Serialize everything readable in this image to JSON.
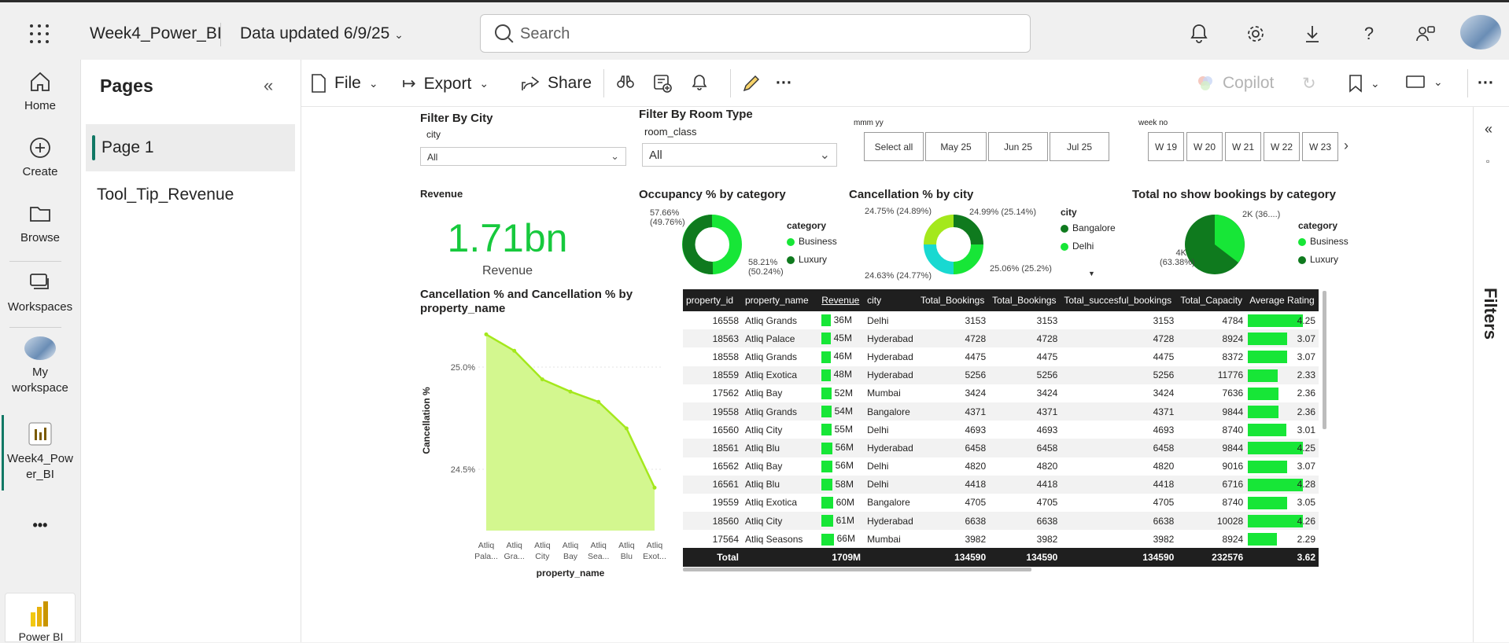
{
  "topbar": {
    "workspace_name": "Week4_Power_BI",
    "data_updated": "Data updated 6/9/25",
    "search_placeholder": "Search"
  },
  "rail": {
    "home": "Home",
    "create": "Create",
    "browse": "Browse",
    "workspaces": "Workspaces",
    "my_workspace": "My workspace",
    "report": "Week4_Power_BI",
    "more": "•••",
    "powerbi": "Power BI"
  },
  "pages": {
    "title": "Pages",
    "items": [
      "Page 1",
      "Tool_Tip_Revenue"
    ]
  },
  "ribbon": {
    "file": "File",
    "export": "Export",
    "share": "Share",
    "copilot": "Copilot"
  },
  "report": {
    "filter_city_title": "Filter By City",
    "filter_city_field": "city",
    "filter_city_value": "All",
    "filter_room_title": "Filter By Room Type",
    "filter_room_field": "room_class",
    "filter_room_value": "All",
    "mmm_label": "mmm yy",
    "months": [
      "Select all",
      "May 25",
      "Jun 25",
      "Jul 25"
    ],
    "week_label": "week no",
    "weeks": [
      "W 19",
      "W 20",
      "W 21",
      "W 22",
      "W 23"
    ],
    "revenue_title": "Revenue",
    "revenue_value": "1.71bn",
    "revenue_sub": "Revenue",
    "occupancy_title": "Occupancy % by category",
    "occupancy_label_top": "57.66%",
    "occupancy_label_top2": "(49.76%)",
    "occupancy_label_bottom": "58.21%",
    "occupancy_label_bottom2": "(50.24%)",
    "legend_category": "category",
    "legend_business": "Business",
    "legend_luxury": "Luxury",
    "cancel_city_title": "Cancellation % by city",
    "cancel_city_l1": "24.75% (24.89%)",
    "cancel_city_l2": "24.99% (25.14%)",
    "cancel_city_l3": "24.63% (24.77%)",
    "cancel_city_l4": "25.06% (25.2%)",
    "legend_city": "city",
    "legend_bangalore": "Bangalore",
    "legend_delhi": "Delhi",
    "noshow_title": "Total no show bookings by category",
    "noshow_l1": "2K (36....)",
    "noshow_l2": "4K",
    "noshow_l3": "(63.38%)",
    "area_title_1": "Cancellation % and Cancellation % by",
    "area_title_2": "property_name",
    "area_ylabel": "Cancellation %",
    "area_xlabel": "property_name"
  },
  "colors": {
    "accent": "#117865",
    "bright_green": "#17e637",
    "dark_green": "#0f7a1e",
    "cyan": "#18d9d1",
    "lime": "#a4e81c",
    "area_fill": "#d3f78f",
    "area_line": "#a4e81c"
  },
  "table": {
    "headers": [
      "property_id",
      "property_name",
      "Revenue",
      "city",
      "Total_Bookings",
      "Total_Bookings",
      "Total_succesful_bookings",
      "Total_Capacity",
      "Average Rating"
    ],
    "rows": [
      [
        "16558",
        "Atliq Grands",
        "36M",
        "Delhi",
        "3153",
        "3153",
        "3153",
        "4784",
        "4.25"
      ],
      [
        "18563",
        "Atliq Palace",
        "45M",
        "Hyderabad",
        "4728",
        "4728",
        "4728",
        "8924",
        "3.07"
      ],
      [
        "18558",
        "Atliq Grands",
        "46M",
        "Hyderabad",
        "4475",
        "4475",
        "4475",
        "8372",
        "3.07"
      ],
      [
        "18559",
        "Atliq Exotica",
        "48M",
        "Hyderabad",
        "5256",
        "5256",
        "5256",
        "11776",
        "2.33"
      ],
      [
        "17562",
        "Atliq Bay",
        "52M",
        "Mumbai",
        "3424",
        "3424",
        "3424",
        "7636",
        "2.36"
      ],
      [
        "19558",
        "Atliq Grands",
        "54M",
        "Bangalore",
        "4371",
        "4371",
        "4371",
        "9844",
        "2.36"
      ],
      [
        "16560",
        "Atliq City",
        "55M",
        "Delhi",
        "4693",
        "4693",
        "4693",
        "8740",
        "3.01"
      ],
      [
        "18561",
        "Atliq Blu",
        "56M",
        "Hyderabad",
        "6458",
        "6458",
        "6458",
        "9844",
        "4.25"
      ],
      [
        "16562",
        "Atliq Bay",
        "56M",
        "Delhi",
        "4820",
        "4820",
        "4820",
        "9016",
        "3.07"
      ],
      [
        "16561",
        "Atliq Blu",
        "58M",
        "Delhi",
        "4418",
        "4418",
        "4418",
        "6716",
        "4.28"
      ],
      [
        "19559",
        "Atliq Exotica",
        "60M",
        "Bangalore",
        "4705",
        "4705",
        "4705",
        "8740",
        "3.05"
      ],
      [
        "18560",
        "Atliq City",
        "61M",
        "Hyderabad",
        "6638",
        "6638",
        "6638",
        "10028",
        "4.26"
      ],
      [
        "17564",
        "Atliq Seasons",
        "66M",
        "Mumbai",
        "3982",
        "3982",
        "3982",
        "8924",
        "2.29"
      ]
    ],
    "total": [
      "Total",
      "",
      "1709M",
      "",
      "134590",
      "134590",
      "134590",
      "232576",
      "3.62"
    ]
  },
  "chart_data": [
    {
      "type": "area",
      "title": "Cancellation % and Cancellation % by property_name",
      "xlabel": "property_name",
      "ylabel": "Cancellation %",
      "categories": [
        "Atliq Pala...",
        "Atliq Gra...",
        "Atliq City",
        "Atliq Bay",
        "Atliq Sea...",
        "Atliq Blu",
        "Atliq Exot..."
      ],
      "values": [
        25.16,
        25.08,
        24.94,
        24.88,
        24.83,
        24.7,
        24.41
      ],
      "yticks": [
        "25.0%",
        "24.5%"
      ],
      "ylim": [
        24.2,
        25.2
      ]
    },
    {
      "type": "pie",
      "title": "Occupancy % by category",
      "categories": [
        "Business",
        "Luxury"
      ],
      "values": [
        57.66,
        58.21
      ]
    },
    {
      "type": "pie",
      "title": "Cancellation % by city",
      "categories": [
        "Delhi",
        "Bangalore",
        "",
        ""
      ],
      "values": [
        24.99,
        25.06,
        24.63,
        24.75
      ]
    },
    {
      "type": "pie",
      "title": "Total no show bookings by category",
      "categories": [
        "Business",
        "Luxury"
      ],
      "values": [
        36.62,
        63.38
      ]
    }
  ]
}
